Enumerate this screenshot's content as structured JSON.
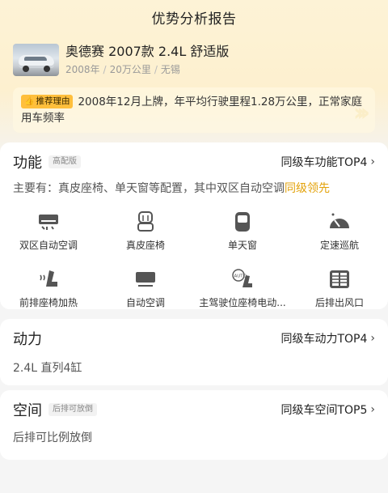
{
  "header": {
    "title": "优势分析报告"
  },
  "car": {
    "name": "奥德赛 2007款 2.4L 舒适版",
    "year": "2008年",
    "mileage": "20万公里",
    "city": "无锡"
  },
  "reason": {
    "badge": "推荐理由",
    "text": "2008年12月上牌，年平均行驶里程1.28万公里，正常家庭用车频率"
  },
  "function": {
    "title": "功能",
    "tag": "高配版",
    "rank": "同级车功能TOP4",
    "desc_prefix": "主要有：真皮座椅、单天窗等配置，其中双区自动空调",
    "desc_highlight": "同级领先",
    "items": [
      {
        "label": "双区自动空调",
        "icon": "dual-ac-icon"
      },
      {
        "label": "真皮座椅",
        "icon": "leather-seat-icon"
      },
      {
        "label": "单天窗",
        "icon": "sunroof-icon"
      },
      {
        "label": "定速巡航",
        "icon": "cruise-icon"
      },
      {
        "label": "前排座椅加热",
        "icon": "seat-heat-icon"
      },
      {
        "label": "自动空调",
        "icon": "auto-ac-icon"
      },
      {
        "label": "主驾驶位座椅电动...",
        "icon": "power-seat-icon"
      },
      {
        "label": "后排出风口",
        "icon": "rear-vent-icon"
      }
    ]
  },
  "power": {
    "title": "动力",
    "rank": "同级车动力TOP4",
    "desc": "2.4L 直列4缸"
  },
  "space": {
    "title": "空间",
    "tag": "后排可放倒",
    "rank": "同级车空间TOP5",
    "desc": "后排可比例放倒"
  }
}
